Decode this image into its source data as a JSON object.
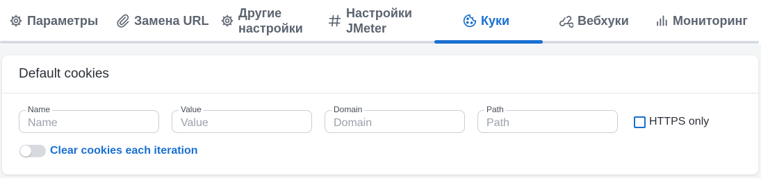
{
  "tabs": [
    {
      "label": "Параметры",
      "icon": "gear-icon"
    },
    {
      "label": "Замена URL",
      "icon": "paperclip-icon"
    },
    {
      "label": "Другие\nнастройки",
      "icon": "gear-icon"
    },
    {
      "label": "Настройки\nJMeter",
      "icon": "hash-icon"
    },
    {
      "label": "Куки",
      "icon": "cookie-icon",
      "active": true
    },
    {
      "label": "Вебхуки",
      "icon": "webhook-icon"
    },
    {
      "label": "Мониторинг",
      "icon": "bar-chart-icon"
    }
  ],
  "card": {
    "title": "Default cookies",
    "fields": [
      {
        "label": "Name",
        "placeholder": "Name",
        "value": ""
      },
      {
        "label": "Value",
        "placeholder": "Value",
        "value": ""
      },
      {
        "label": "Domain",
        "placeholder": "Domain",
        "value": ""
      },
      {
        "label": "Path",
        "placeholder": "Path",
        "value": ""
      }
    ],
    "https_only": {
      "label": "HTTPS only",
      "checked": false
    },
    "clear_cookies": {
      "label": "Clear cookies each iteration",
      "enabled": false
    }
  },
  "colors": {
    "accent": "#1a6fd1",
    "tab_text": "#5c6470",
    "border": "#c9cdd3"
  }
}
